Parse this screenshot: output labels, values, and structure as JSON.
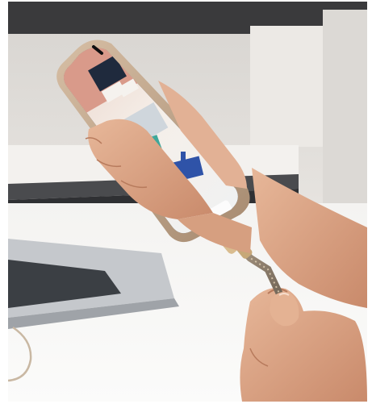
{
  "image": {
    "kind": "product-photo",
    "subject": "hands-plugging-charging-cable-into-smartphone",
    "palette": {
      "background": "#e9e7e4",
      "wall_dark": "#2f2f31",
      "shelf": "#f1efec",
      "table": "#f5f4f2",
      "laptop": "#b9bcc0",
      "laptop_keys": "#3b3f44",
      "skin": "#e0ad8e",
      "skin_shadow": "#c98a6b",
      "phone_frame": "#c2a68b",
      "cable_gold": "#d9bc8f",
      "cable_braid": "#8c7d6d",
      "screen_room": "#f6efe9",
      "chair_blue": "#2f53a8",
      "accent_orange": "#c56d46"
    }
  }
}
